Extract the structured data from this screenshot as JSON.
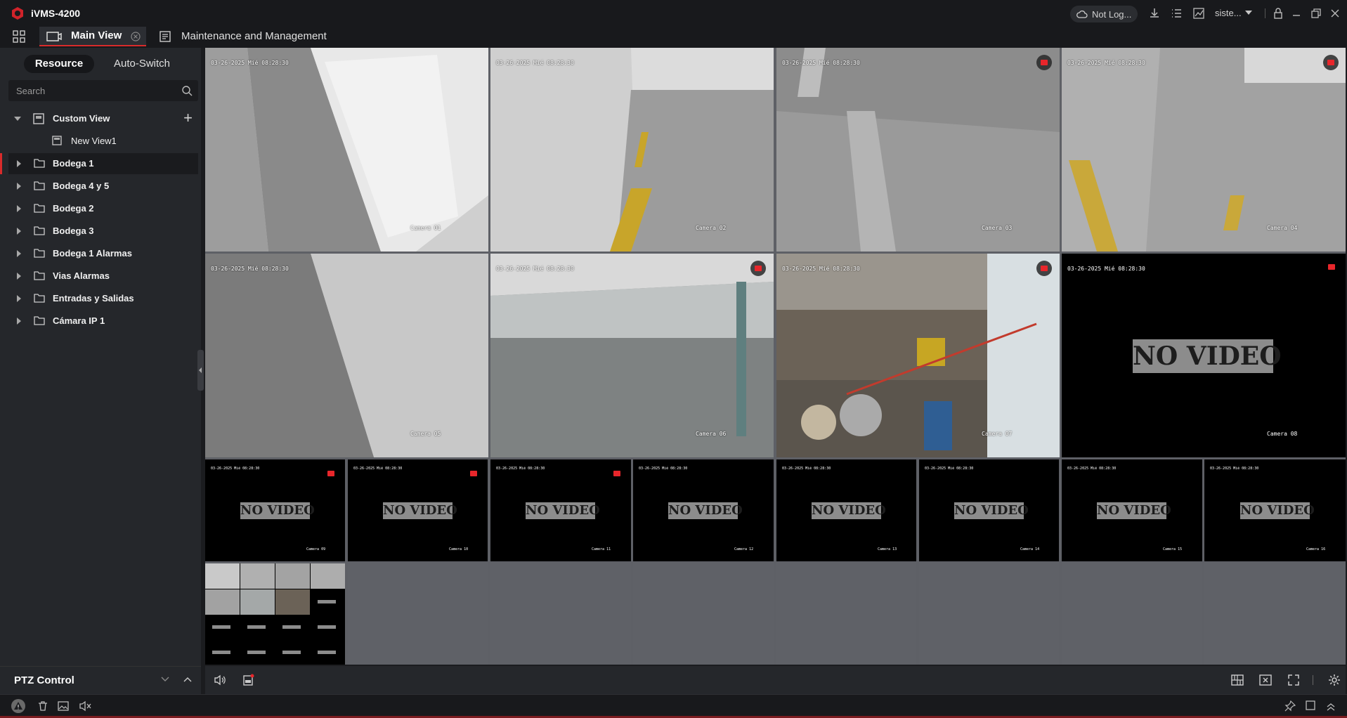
{
  "app": {
    "title": "iVMS-4200"
  },
  "titlebar": {
    "login_status": "Not Log...",
    "user": "siste..."
  },
  "tabs": {
    "main_view": "Main View",
    "maintenance": "Maintenance and Management"
  },
  "sidebar": {
    "seg_resource": "Resource",
    "seg_autoswitch": "Auto-Switch",
    "search_placeholder": "Search",
    "custom_view": "Custom View",
    "new_view": "New View1",
    "groups": [
      "Bodega 1",
      "Bodega 4 y 5",
      "Bodega 2",
      "Bodega 3",
      "Bodega 1 Alarmas",
      "Vias Alarmas",
      "Entradas y Salidas",
      "Cámara IP 1"
    ],
    "ptz": "PTZ Control"
  },
  "cameras": {
    "timestamp": "03-26-2025 Mié 08:28:30",
    "names": [
      "Camera 01",
      "Camera 02",
      "Camera 03",
      "Camera 04",
      "Camera 05",
      "Camera 06",
      "Camera 07",
      "Camera 08",
      "Camera 09",
      "Camera 10",
      "Camera 11",
      "Camera 12",
      "Camera 13",
      "Camera 14",
      "Camera 15",
      "Camera 16"
    ],
    "no_video": "NO VIDEO"
  },
  "colors": {
    "accent": "#d92b2b",
    "background": "#1b1c1f",
    "panel": "#25272b"
  }
}
